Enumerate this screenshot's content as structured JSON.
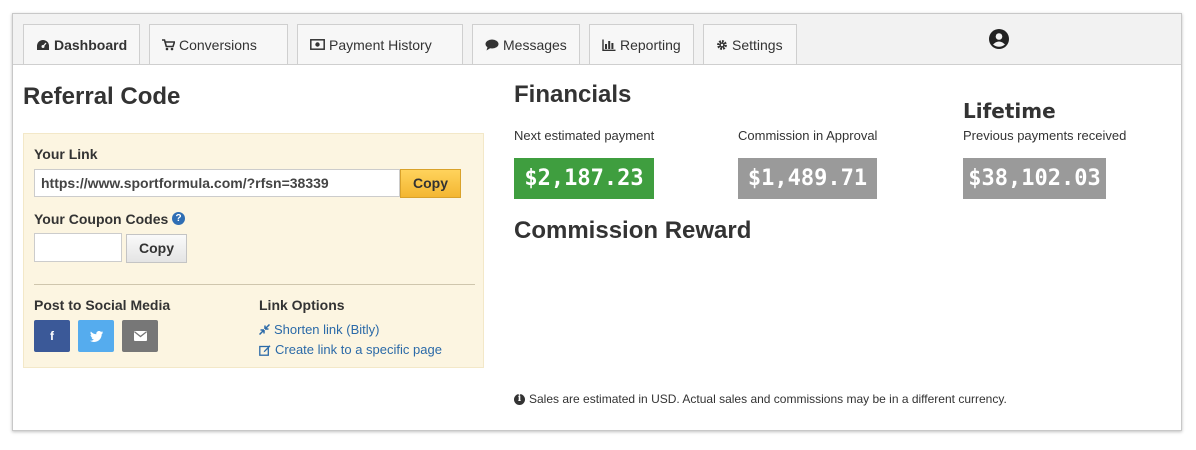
{
  "nav": {
    "tabs": [
      {
        "label": "Dashboard",
        "icon": "dashboard-icon",
        "active": true
      },
      {
        "label": "Conversions",
        "icon": "cart-icon"
      },
      {
        "label": "Payment History",
        "icon": "money-icon"
      },
      {
        "label": "Messages",
        "icon": "comment-icon"
      },
      {
        "label": "Reporting",
        "icon": "bar-chart-icon"
      },
      {
        "label": "Settings",
        "icon": "gear-icon"
      }
    ],
    "user_icon": "user-circle-icon"
  },
  "referral": {
    "title": "Referral Code",
    "your_link_label": "Your Link",
    "link_value": "https://www.sportformula.com/?rfsn=38339",
    "copy_label": "Copy",
    "coupon_label": "Your Coupon Codes",
    "coupon_value": "",
    "coupon_copy_label": "Copy",
    "social_label": "Post to Social Media",
    "social_buttons": [
      {
        "icon": "facebook-icon",
        "glyph": "f",
        "color": "#3b5998"
      },
      {
        "icon": "twitter-icon",
        "glyph": "",
        "color": "#55acee"
      },
      {
        "icon": "envelope-icon",
        "glyph": "",
        "color": "#777777"
      }
    ],
    "link_options_label": "Link Options",
    "shorten_link": "Shorten link (Bitly)",
    "create_link": "Create link to a specific page"
  },
  "financials": {
    "title": "Financials",
    "lifetime_title": "Lifetime",
    "next_payment_label": "Next estimated payment",
    "next_payment_value": "$2,187.23",
    "approval_label": "Commission in Approval",
    "approval_value": "$1,489.71",
    "previous_label": "Previous payments received",
    "previous_value": "$38,102.03",
    "colors": {
      "green": "#3f9e3f",
      "gray": "#9a9a9a"
    }
  },
  "commission": {
    "title": "Commission Reward"
  },
  "footer_note": "Sales are estimated in USD. Actual sales and commissions may be in a different currency."
}
